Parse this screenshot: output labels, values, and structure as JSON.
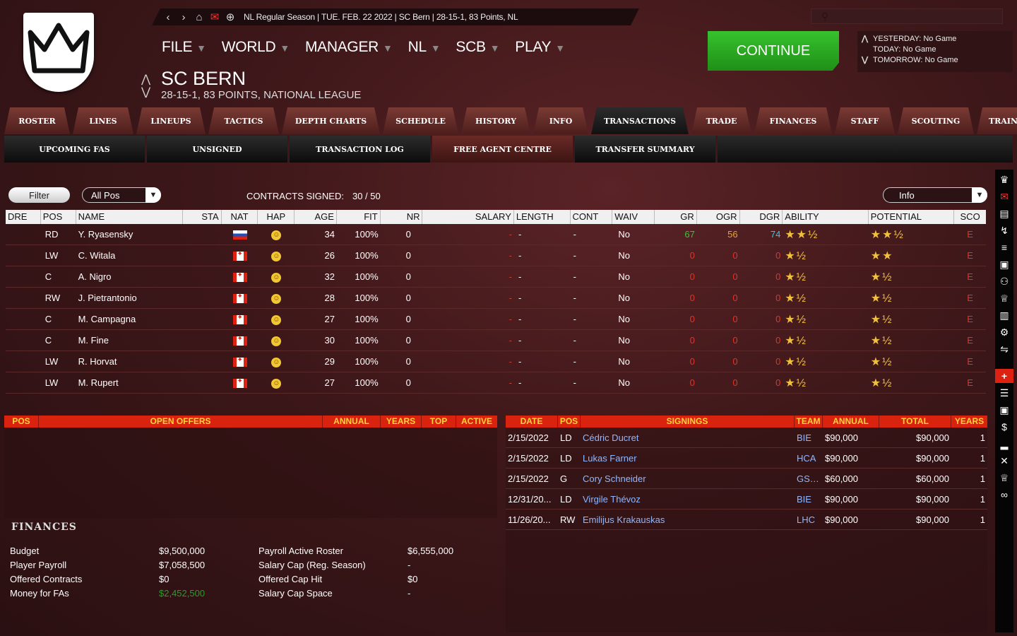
{
  "topbar": {
    "info": "NL Regular Season |  TUE. FEB. 22 2022 |  SC Bern |   28-15-1, 83 Points, NL"
  },
  "menu": [
    "FILE",
    "WORLD",
    "MANAGER",
    "NL",
    "SCB",
    "PLAY"
  ],
  "team": {
    "name": "SC BERN",
    "record": "28-15-1, 83 POINTS, NATIONAL LEAGUE"
  },
  "continue_label": "CONTINUE",
  "games": {
    "yesterday": "YESTERDAY: No Game",
    "today": "TODAY: No Game",
    "tomorrow": "TOMORROW: No Game"
  },
  "tabs": [
    "ROSTER",
    "LINES",
    "LINEUPS",
    "TACTICS",
    "DEPTH CHARTS",
    "SCHEDULE",
    "HISTORY",
    "INFO",
    "TRANSACTIONS",
    "TRADE",
    "FINANCES",
    "STAFF",
    "SCOUTING",
    "TRAIN"
  ],
  "subtabs": [
    "UPCOMING FAS",
    "UNSIGNED",
    "TRANSACTION LOG",
    "FREE AGENT CENTRE",
    "TRANSFER SUMMARY"
  ],
  "filter": {
    "button": "Filter",
    "position": "All Pos",
    "contracts_label": "CONTRACTS SIGNED:",
    "contracts_value": "30 / 50",
    "info": "Info"
  },
  "player_headers": [
    "DRE",
    "POS",
    "NAME",
    "STA",
    "NAT",
    "HAP",
    "AGE",
    "FIT",
    "NR",
    "SALARY",
    "LENGTH",
    "CONT",
    "WAIV",
    "GR",
    "OGR",
    "DGR",
    "ABILITY",
    "POTENTIAL",
    "SCO"
  ],
  "players": [
    {
      "pos": "RD",
      "name": "Y. Ryasensky",
      "nat": "ru",
      "age": "34",
      "fit": "100%",
      "nr": "0",
      "salary": "-",
      "length": "-",
      "cont": "-",
      "waiv": "No",
      "gr": "67",
      "ogr": "56",
      "dgr": "74",
      "ability": "★★½",
      "potential": "★★½",
      "sco": "E"
    },
    {
      "pos": "LW",
      "name": "C. Witala",
      "nat": "ca",
      "age": "26",
      "fit": "100%",
      "nr": "0",
      "salary": "-",
      "length": "-",
      "cont": "-",
      "waiv": "No",
      "gr": "0",
      "ogr": "0",
      "dgr": "0",
      "ability": "★½",
      "potential": "★★",
      "sco": "E"
    },
    {
      "pos": "C",
      "name": "A. Nigro",
      "nat": "ca",
      "age": "32",
      "fit": "100%",
      "nr": "0",
      "salary": "-",
      "length": "-",
      "cont": "-",
      "waiv": "No",
      "gr": "0",
      "ogr": "0",
      "dgr": "0",
      "ability": "★½",
      "potential": "★½",
      "sco": "E"
    },
    {
      "pos": "RW",
      "name": "J. Pietrantonio",
      "nat": "ca",
      "age": "28",
      "fit": "100%",
      "nr": "0",
      "salary": "-",
      "length": "-",
      "cont": "-",
      "waiv": "No",
      "gr": "0",
      "ogr": "0",
      "dgr": "0",
      "ability": "★½",
      "potential": "★½",
      "sco": "E"
    },
    {
      "pos": "C",
      "name": "M. Campagna",
      "nat": "ca",
      "age": "27",
      "fit": "100%",
      "nr": "0",
      "salary": "-",
      "length": "-",
      "cont": "-",
      "waiv": "No",
      "gr": "0",
      "ogr": "0",
      "dgr": "0",
      "ability": "★½",
      "potential": "★½",
      "sco": "E"
    },
    {
      "pos": "C",
      "name": "M. Fine",
      "nat": "ca",
      "age": "30",
      "fit": "100%",
      "nr": "0",
      "salary": "-",
      "length": "-",
      "cont": "-",
      "waiv": "No",
      "gr": "0",
      "ogr": "0",
      "dgr": "0",
      "ability": "★½",
      "potential": "★½",
      "sco": "E"
    },
    {
      "pos": "LW",
      "name": "R. Horvat",
      "nat": "ca",
      "age": "29",
      "fit": "100%",
      "nr": "0",
      "salary": "-",
      "length": "-",
      "cont": "-",
      "waiv": "No",
      "gr": "0",
      "ogr": "0",
      "dgr": "0",
      "ability": "★½",
      "potential": "★½",
      "sco": "E"
    },
    {
      "pos": "LW",
      "name": "M. Rupert",
      "nat": "ca",
      "age": "27",
      "fit": "100%",
      "nr": "0",
      "salary": "-",
      "length": "-",
      "cont": "-",
      "waiv": "No",
      "gr": "0",
      "ogr": "0",
      "dgr": "0",
      "ability": "★½",
      "potential": "★½",
      "sco": "E"
    }
  ],
  "offer_headers": [
    "POS",
    "OPEN OFFERS",
    "ANNUAL",
    "YEARS",
    "TOP",
    "ACTIVE"
  ],
  "finances": {
    "title": "FINANCES",
    "budget_label": "Budget",
    "budget": "$9,500,000",
    "payroll_label": "Player Payroll",
    "payroll": "$7,058,500",
    "offered_label": "Offered Contracts",
    "offered": "$0",
    "money_label": "Money for FAs",
    "money": "$2,452,500",
    "active_label": "Payroll Active Roster",
    "active": "$6,555,000",
    "cap_label": "Salary Cap (Reg. Season)",
    "cap": "-",
    "caphit_label": "Offered Cap Hit",
    "caphit": "$0",
    "capspace_label": "Salary Cap Space",
    "capspace": "-"
  },
  "signing_headers": [
    "DATE",
    "POS",
    "SIGNINGS",
    "TEAM",
    "ANNUAL",
    "TOTAL",
    "YEARS"
  ],
  "signings": [
    {
      "date": "2/15/2022",
      "pos": "LD",
      "name": "Cédric Ducret",
      "team": "BIE",
      "annual": "$90,000",
      "total": "$90,000",
      "years": "1"
    },
    {
      "date": "2/15/2022",
      "pos": "LD",
      "name": "Lukas Farner",
      "team": "HCA",
      "annual": "$90,000",
      "total": "$90,000",
      "years": "1"
    },
    {
      "date": "2/15/2022",
      "pos": "G",
      "name": "Cory Schneider",
      "team": "GSHC",
      "annual": "$60,000",
      "total": "$60,000",
      "years": "1"
    },
    {
      "date": "12/31/20...",
      "pos": "LD",
      "name": "Virgile Thévoz",
      "team": "BIE",
      "annual": "$90,000",
      "total": "$90,000",
      "years": "1"
    },
    {
      "date": "11/26/20...",
      "pos": "RW",
      "name": "Emilijus Krakauskas",
      "team": "LHC",
      "annual": "$90,000",
      "total": "$90,000",
      "years": "1"
    }
  ],
  "colors": {
    "accent": "#d9230f",
    "continue": "#2fae25",
    "background": "#3d1719"
  }
}
